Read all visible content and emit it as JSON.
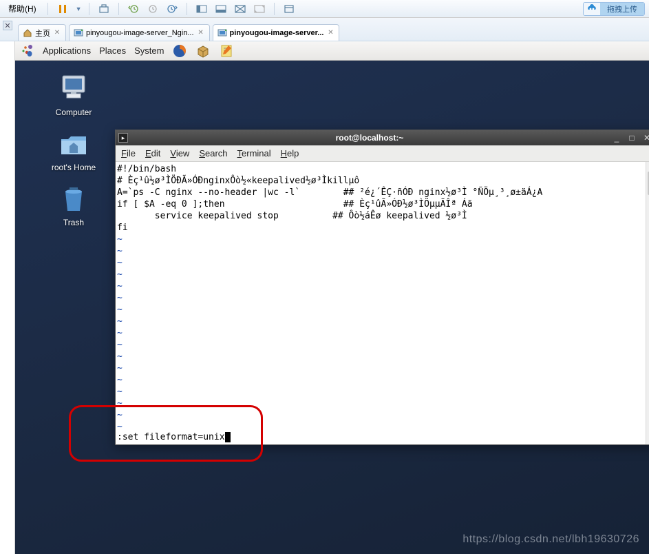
{
  "host_toolbar": {
    "help_menu": "帮助(H)",
    "upload_label": "拖拽上传"
  },
  "tabs": [
    {
      "label": "主页",
      "icon": "home"
    },
    {
      "label": "pinyougou-image-server_Ngin...",
      "icon": "vm"
    },
    {
      "label": "pinyougou-image-server...",
      "icon": "vm",
      "active": true
    }
  ],
  "gnome": {
    "menus": [
      "Applications",
      "Places",
      "System"
    ]
  },
  "desktop_icons": [
    {
      "name": "Computer"
    },
    {
      "name": "root's Home"
    },
    {
      "name": "Trash"
    }
  ],
  "terminal": {
    "title": "root@localhost:~",
    "menus": [
      {
        "m": "F",
        "rest": "ile"
      },
      {
        "m": "E",
        "rest": "dit"
      },
      {
        "m": "V",
        "rest": "iew"
      },
      {
        "m": "S",
        "rest": "earch"
      },
      {
        "m": "T",
        "rest": "erminal"
      },
      {
        "m": "H",
        "rest": "elp"
      }
    ],
    "lines": [
      "#!/bin/bash",
      "# Èç¹û½ø³ÌÖÐÃ»ÓÐnginxÔò½«keepalived½ø³Ìkillµô",
      "A=`ps -C nginx --no-header |wc -l`        ## ²é¿´ÊÇ·ñÓÐ nginx½ø³Ì °ÑÖµ¸³¸ø±äÁ¿A",
      "if [ $A -eq 0 ];then                      ## Èç¹ûÃ»ÓÐ½ø³ÌÖµµÃÎª Áã",
      "       service keepalived stop          ## Ôò½áÊø keepalived ½ø³Ì",
      "fi"
    ],
    "tilde_rows": 17,
    "command": ":set fileformat=unix"
  },
  "watermark": "https://blog.csdn.net/lbh19630726"
}
